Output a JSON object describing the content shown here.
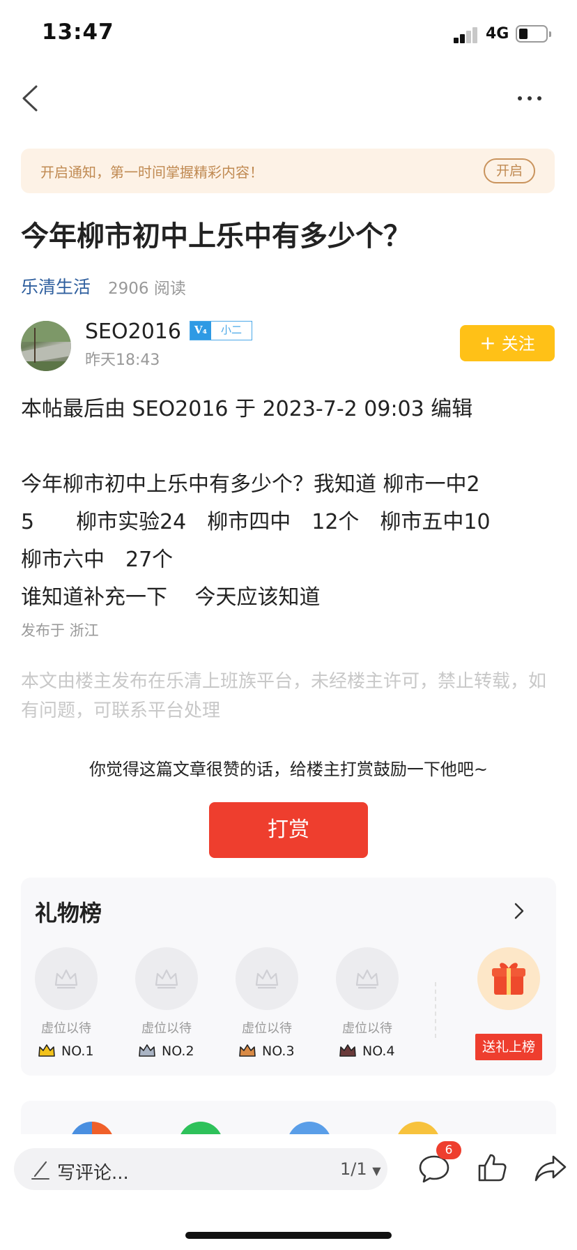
{
  "status_bar": {
    "time": "13:47",
    "network": "4G"
  },
  "nav": {
    "back_icon": "chevron-left-icon",
    "more_icon": "more-dots-icon"
  },
  "notice": {
    "text": "开启通知，第一时间掌握精彩内容！",
    "button": "开启"
  },
  "post": {
    "title": "今年柳市初中上乐中有多少个？",
    "circle": "乐清生活",
    "reads": "2906 阅读",
    "author": "SEO2016",
    "level_badge": "小二",
    "time": "昨天18:43",
    "follow_label": "关注",
    "body_lines": [
      "本帖最后由 SEO2016 于 2023-7-2 09:03 编辑",
      "今年柳市初中上乐中有多少个？我知道 柳市一中2",
      "5　　柳市实验24　柳市四中　12个　柳市五中10",
      "柳市六中　27个",
      "谁知道补充一下　 今天应该知道"
    ],
    "location": "发布于 浙江",
    "disclaimer": "本文由楼主发布在乐清上班族平台，未经楼主许可，禁止转载，如有问题，可联系平台处理"
  },
  "reward": {
    "prompt": "你觉得这篇文章很赞的话，给楼主打赏鼓励一下他吧~",
    "button": "打赏"
  },
  "gift_board": {
    "title": "礼物榜",
    "slots": [
      {
        "caption": "虚位以待",
        "rank": "NO.1",
        "crown_color": "#f2c21b"
      },
      {
        "caption": "虚位以待",
        "rank": "NO.2",
        "crown_color": "#aab4c4"
      },
      {
        "caption": "虚位以待",
        "rank": "NO.3",
        "crown_color": "#d98a45"
      },
      {
        "caption": "虚位以待",
        "rank": "NO.4",
        "crown_color": "#6a3a3a"
      }
    ],
    "send_gift": "送礼上榜"
  },
  "bottom_bar": {
    "comment_placeholder": "写评论...",
    "page_indicator": "1/1",
    "comment_count": "6"
  },
  "colors": {
    "accent_red": "#ee3e2e",
    "follow_yellow": "#ffc117",
    "notice_bg": "#fdf2e6",
    "link_blue": "#2f5f9e"
  }
}
